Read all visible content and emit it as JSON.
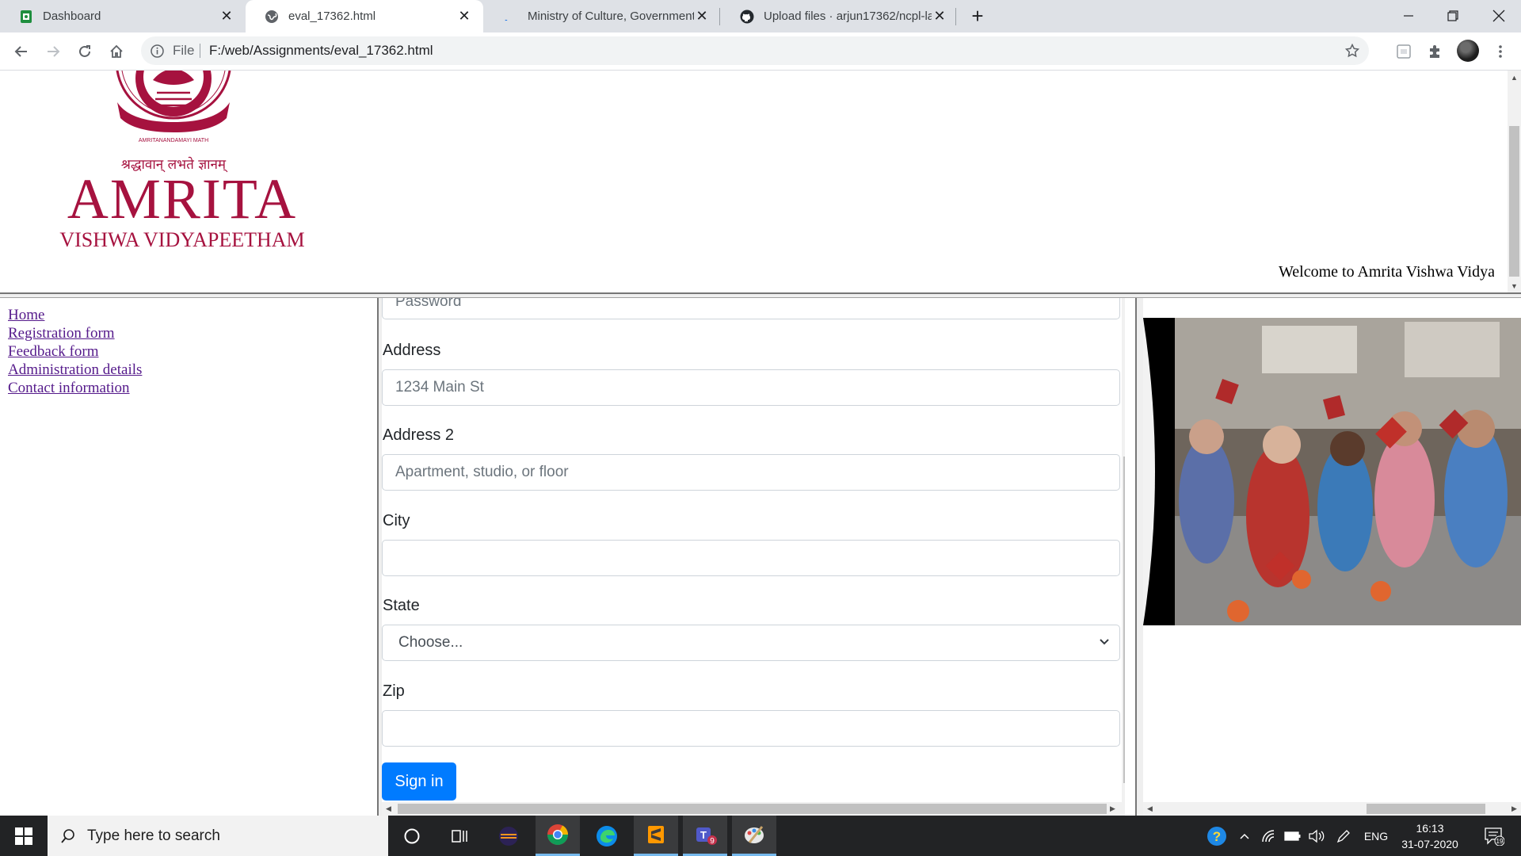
{
  "browser": {
    "tabs": [
      {
        "title": "Dashboard",
        "icon": "google-classroom-icon"
      },
      {
        "title": "eval_17362.html",
        "icon": "globe-icon",
        "active": true
      },
      {
        "title": "Ministry of Culture, Government",
        "icon": "loading-icon"
      },
      {
        "title": "Upload files · arjun17362/ncpl-la",
        "icon": "github-icon"
      }
    ],
    "address": {
      "scheme_label": "File",
      "url": "F:/web/Assignments/eval_17362.html"
    }
  },
  "banner": {
    "logo": {
      "hindi_motto": "श्रद्धावान् लभते ज्ञानम्",
      "name": "AMRITA",
      "subtitle": "VISHWA VIDYAPEETHAM",
      "seal_text": "AMRITANANDAMAYI MATH"
    },
    "welcome_text": "Welcome to Amrita Vishwa Vidyapeetham"
  },
  "nav": {
    "links": [
      "Home",
      "Registration form",
      "Feedback form",
      "Administration details",
      "Contact information"
    ]
  },
  "form": {
    "password_placeholder": "Password",
    "address_label": "Address",
    "address_placeholder": "1234 Main St",
    "address2_label": "Address 2",
    "address2_placeholder": "Apartment, studio, or floor",
    "city_label": "City",
    "city_value": "",
    "state_label": "State",
    "state_selected": "Choose...",
    "zip_label": "Zip",
    "zip_value": "",
    "submit_label": "Sign in"
  },
  "taskbar": {
    "search_placeholder": "Type here to search",
    "teams_badge": "9",
    "language": "ENG",
    "time": "16:13",
    "date": "31-07-2020",
    "notifications_count": "19"
  },
  "colors": {
    "amrita_maroon": "#a6123f",
    "primary_button": "#007bff",
    "visited_link": "#551a8b",
    "taskbar": "#222325"
  }
}
